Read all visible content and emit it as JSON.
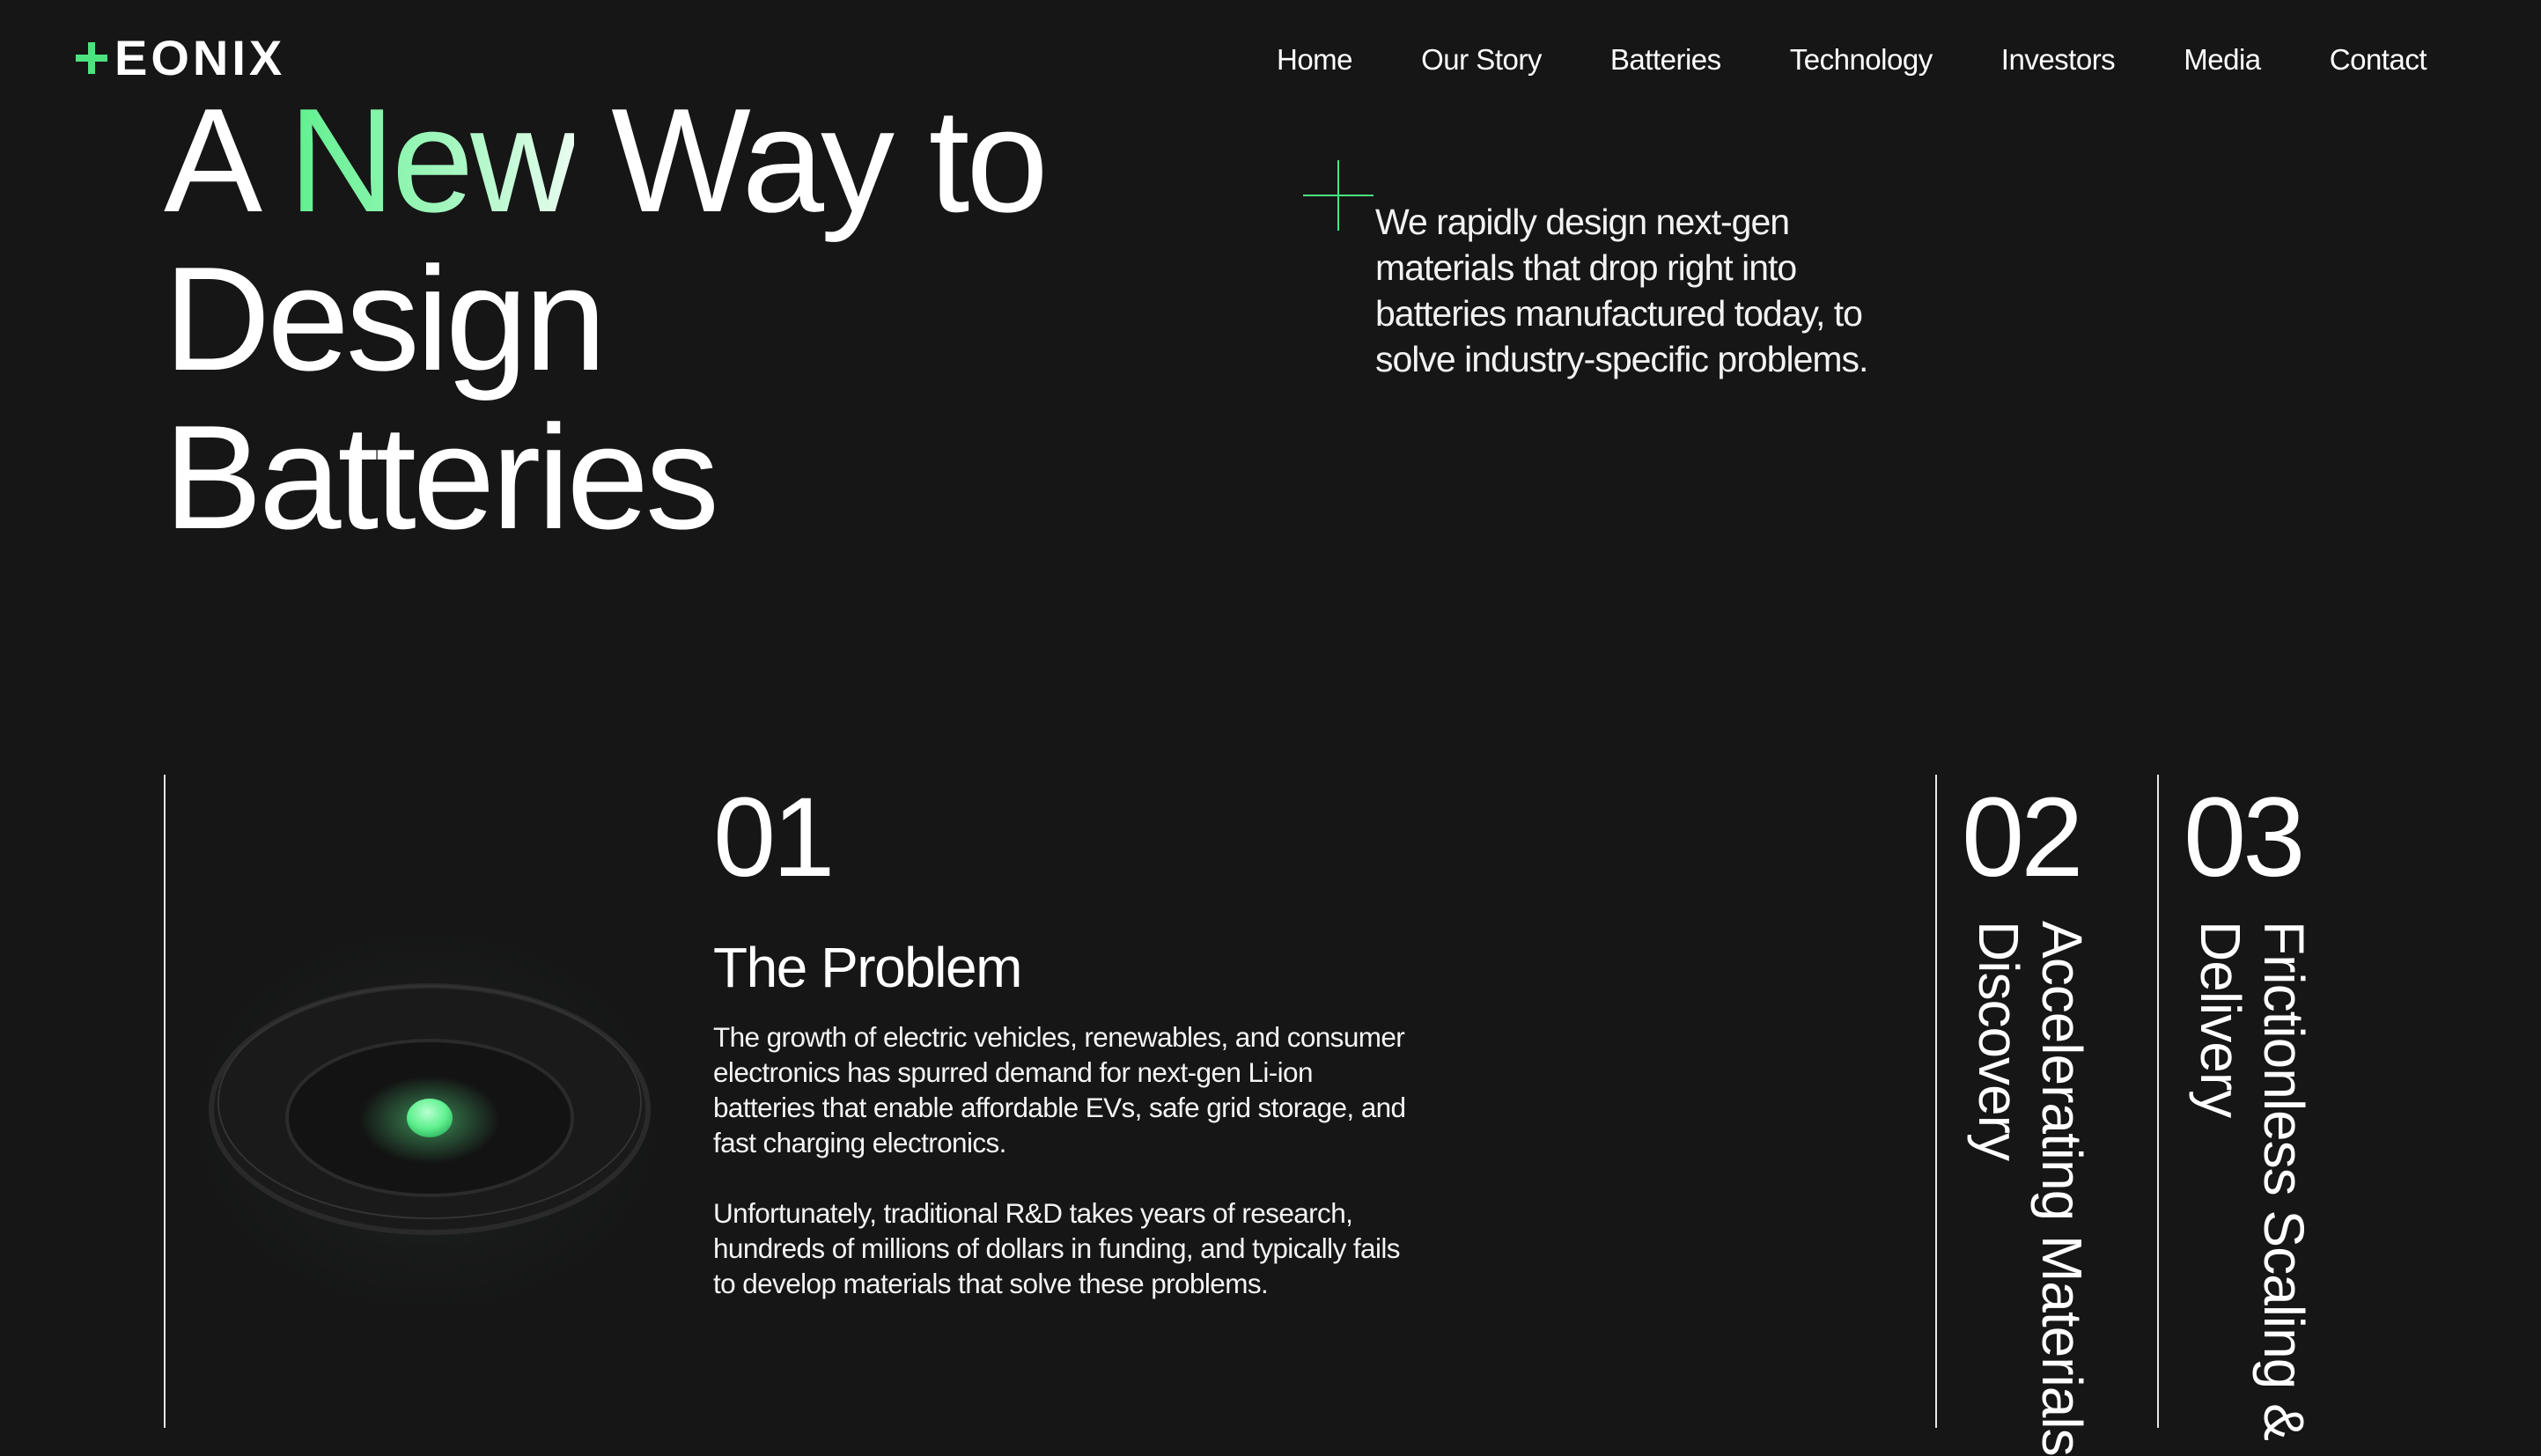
{
  "brand": {
    "logo_text": "EONIX",
    "logo_accent": "#4be37f"
  },
  "nav": {
    "items": [
      "Home",
      "Our Story",
      "Batteries",
      "Technology",
      "Investors",
      "Media",
      "Contact"
    ]
  },
  "hero": {
    "line1_pre": "A ",
    "line1_accent": "New",
    "line1_post": " Way to",
    "line2": "Design",
    "line3": "Batteries",
    "intro": "We rapidly design next-gen materials that drop right into batteries manufactured today, to solve industry-specific problems."
  },
  "steps": [
    {
      "number": "01",
      "title": "The Problem",
      "paragraph1": "The growth of electric vehicles, renewables, and consumer electronics has spurred demand for next-gen Li-ion batteries that enable affordable EVs, safe grid storage, and fast charging electronics.",
      "paragraph2": "Unfortunately, traditional R&D takes years of research, hundreds of millions of dollars in funding, and typically fails to develop materials that solve these problems."
    },
    {
      "number": "02",
      "title_line1": "Accelerating Materials",
      "title_line2": "Discovery"
    },
    {
      "number": "03",
      "title_line1": "Frictionless Scaling &",
      "title_line2": "Delivery"
    }
  ],
  "colors": {
    "background": "#161616",
    "accent": "#5ef08e",
    "text": "#ffffff"
  }
}
